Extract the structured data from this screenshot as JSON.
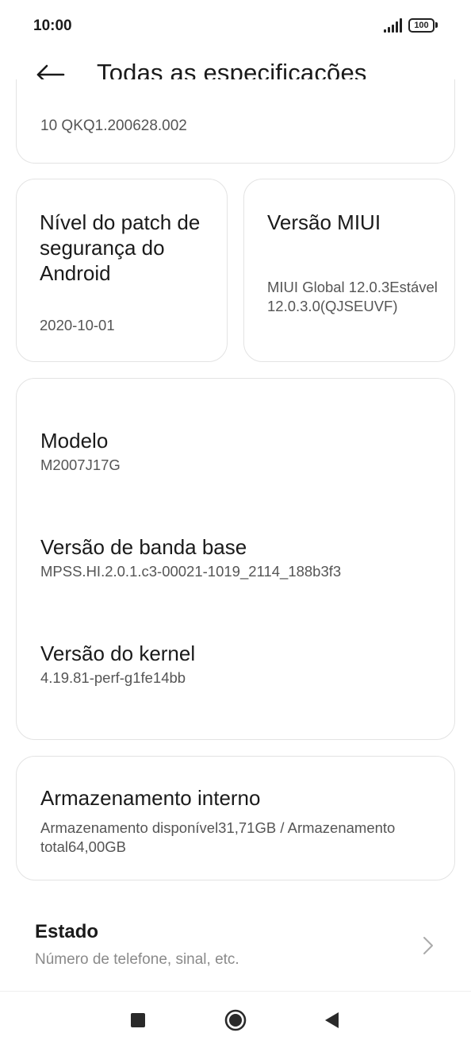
{
  "status_bar": {
    "time": "10:00",
    "battery": "100",
    "icons": [
      "signal-icon",
      "battery-icon"
    ]
  },
  "header": {
    "title": "Todas as especificações",
    "back_icon": "arrow-left-icon"
  },
  "cards": {
    "top_partial_value": "10 QKQ1.200628.002",
    "patch": {
      "label": "Nível do patch de segurança do Android",
      "value": "2020-10-01"
    },
    "miui": {
      "label": "Versão MIUI",
      "value": "MIUI Global 12.0.3Estável 12.0.3.0(QJSEUVF)"
    },
    "info": [
      {
        "label": "Modelo",
        "value": "M2007J17G"
      },
      {
        "label": "Versão de banda base",
        "value": "MPSS.HI.2.0.1.c3-00021-1019_2114_188b3f3"
      },
      {
        "label": "Versão do kernel",
        "value": "4.19.81-perf-g1fe14bb"
      }
    ],
    "storage": {
      "label": "Armazenamento interno",
      "value": "Armazenamento disponível31,71GB / Armazenamento total64,00GB"
    }
  },
  "estado": {
    "title": "Estado",
    "subtitle": "Número de telefone, sinal, etc.",
    "icon": "chevron-right-icon"
  },
  "nav_bar": {
    "buttons": [
      "recents-square-icon",
      "home-circle-icon",
      "back-triangle-icon"
    ]
  }
}
